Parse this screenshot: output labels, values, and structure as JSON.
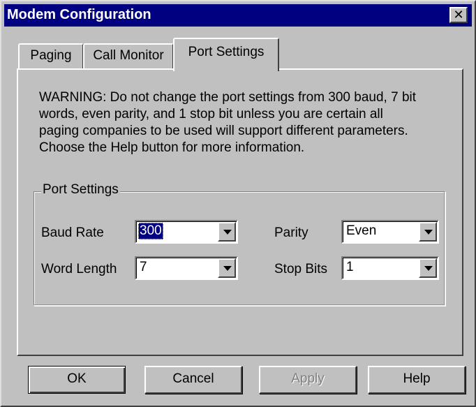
{
  "window": {
    "title": "Modem Configuration",
    "close_label": "✕"
  },
  "tabs": [
    {
      "label": "Paging",
      "active": false
    },
    {
      "label": "Call Monitor",
      "active": false
    },
    {
      "label": "Port Settings",
      "active": true
    }
  ],
  "panel": {
    "warning_lines": [
      "WARNING: Do not change the port settings from 300 baud, 7 bit",
      "words, even parity, and 1 stop bit unless you are certain all",
      "paging companies to be used will support different parameters.",
      "Choose the Help button for more information."
    ],
    "group_label": "Port Settings",
    "baud_rate": {
      "label": "Baud Rate",
      "value": "300"
    },
    "parity": {
      "label": "Parity",
      "value": "Even"
    },
    "word_length": {
      "label": "Word Length",
      "value": "7"
    },
    "stop_bits": {
      "label": "Stop Bits",
      "value": "1"
    }
  },
  "buttons": {
    "ok": "OK",
    "cancel": "Cancel",
    "apply": "Apply",
    "help": "Help"
  },
  "colors": {
    "titlebar": "#000080",
    "face": "#c0c0c0",
    "selection": "#000080"
  }
}
